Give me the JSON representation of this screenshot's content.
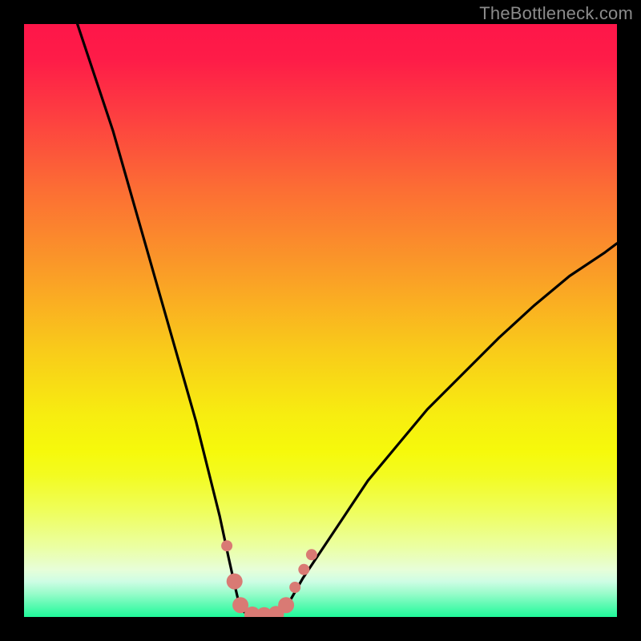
{
  "watermark": {
    "text": "TheBottleneck.com"
  },
  "gradient": {
    "top_color": "#fe1649",
    "bottom_color": "#20f99a",
    "note": "red-orange-yellow-green vertical gradient"
  },
  "curve_style": {
    "stroke": "#000000",
    "stroke_width": 3.2,
    "marker_fill": "#d97a74",
    "marker_radius_small": 7,
    "marker_radius_large": 10
  },
  "chart_data": {
    "type": "line",
    "title": "",
    "xlabel": "",
    "ylabel": "",
    "xlim": [
      0,
      100
    ],
    "ylim": [
      0,
      100
    ],
    "series": [
      {
        "name": "left-branch",
        "x": [
          9,
          11,
          13,
          15,
          17,
          19,
          21,
          23,
          25,
          27,
          29,
          31,
          33,
          34.5,
          35.5,
          36.2,
          36.8
        ],
        "y": [
          100,
          94,
          88,
          82,
          75,
          68,
          61,
          54,
          47,
          40,
          33,
          25,
          17,
          10,
          5.5,
          2.5,
          1
        ]
      },
      {
        "name": "floor",
        "x": [
          36.8,
          38,
          39.5,
          41,
          42.5,
          43.7
        ],
        "y": [
          1,
          0.4,
          0.2,
          0.2,
          0.4,
          1
        ]
      },
      {
        "name": "right-branch",
        "x": [
          43.7,
          45,
          47,
          50,
          54,
          58,
          63,
          68,
          74,
          80,
          86,
          92,
          98,
          100
        ],
        "y": [
          1,
          3,
          6.5,
          11,
          17,
          23,
          29,
          35,
          41,
          47,
          52.5,
          57.5,
          61.5,
          63
        ]
      }
    ],
    "markers": [
      {
        "series": "left-branch",
        "x": 34.2,
        "y": 12,
        "r": "small"
      },
      {
        "series": "left-branch",
        "x": 35.5,
        "y": 6,
        "r": "large"
      },
      {
        "series": "left-branch",
        "x": 36.5,
        "y": 2,
        "r": "large"
      },
      {
        "series": "floor",
        "x": 38.5,
        "y": 0.4,
        "r": "large"
      },
      {
        "series": "floor",
        "x": 40.5,
        "y": 0.3,
        "r": "large"
      },
      {
        "series": "floor",
        "x": 42.5,
        "y": 0.5,
        "r": "large"
      },
      {
        "series": "right-branch",
        "x": 44.2,
        "y": 2,
        "r": "large"
      },
      {
        "series": "right-branch",
        "x": 45.7,
        "y": 5,
        "r": "small"
      },
      {
        "series": "right-branch",
        "x": 47.2,
        "y": 8,
        "r": "small"
      },
      {
        "series": "right-branch",
        "x": 48.5,
        "y": 10.5,
        "r": "small"
      }
    ]
  }
}
